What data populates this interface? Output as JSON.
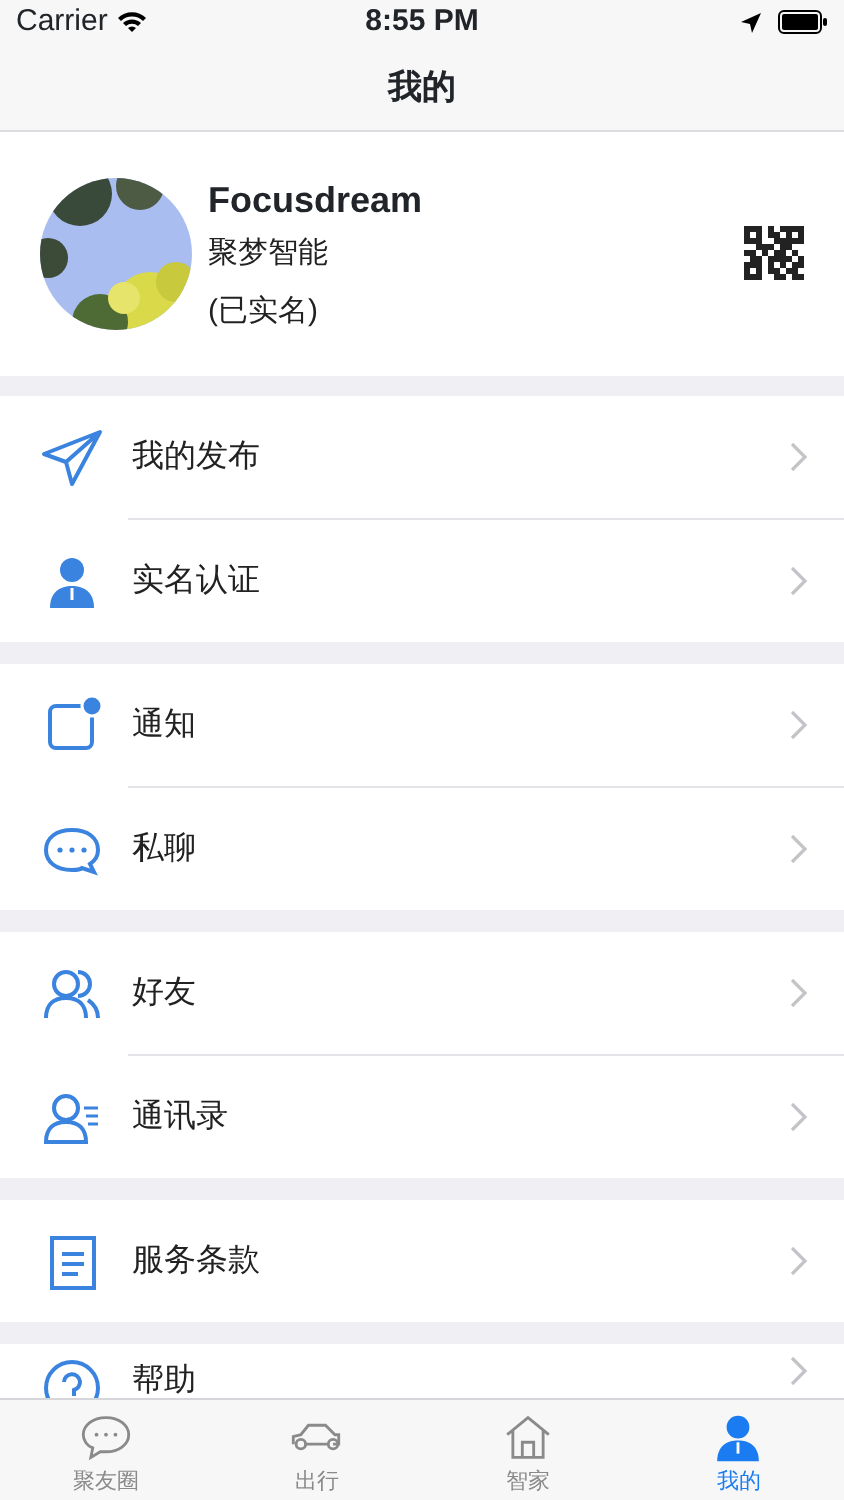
{
  "status_bar": {
    "carrier": "Carrier",
    "time": "8:55 PM"
  },
  "nav": {
    "title": "我的"
  },
  "profile": {
    "name": "Focusdream",
    "company": "聚梦智能",
    "verification": "(已实名)"
  },
  "groups": [
    {
      "items": [
        {
          "label": "我的发布"
        },
        {
          "label": "实名认证"
        }
      ]
    },
    {
      "items": [
        {
          "label": "通知"
        },
        {
          "label": "私聊"
        }
      ]
    },
    {
      "items": [
        {
          "label": "好友"
        },
        {
          "label": "通讯录"
        }
      ]
    },
    {
      "items": [
        {
          "label": "服务条款"
        }
      ]
    },
    {
      "items": [
        {
          "label": "帮助"
        }
      ]
    }
  ],
  "tabs": [
    {
      "label": "聚友圈",
      "selected": false
    },
    {
      "label": "出行",
      "selected": false
    },
    {
      "label": "智家",
      "selected": false
    },
    {
      "label": "我的",
      "selected": true
    }
  ]
}
